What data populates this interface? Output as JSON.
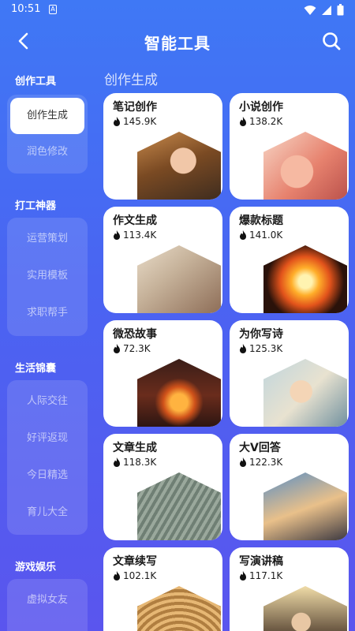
{
  "status_bar": {
    "time": "10:51",
    "sim_label": "A"
  },
  "header": {
    "title": "智能工具"
  },
  "sidebar": {
    "groups": [
      {
        "title": "创作工具",
        "items": [
          {
            "label": "创作生成",
            "active": true
          },
          {
            "label": "润色修改",
            "active": false
          }
        ]
      },
      {
        "title": "打工神器",
        "items": [
          {
            "label": "运营策划"
          },
          {
            "label": "实用模板"
          },
          {
            "label": "求职帮手"
          }
        ]
      },
      {
        "title": "生活锦囊",
        "items": [
          {
            "label": "人际交往"
          },
          {
            "label": "好评返现"
          },
          {
            "label": "今日精选"
          },
          {
            "label": "育儿大全"
          }
        ]
      },
      {
        "title": "游戏娱乐",
        "items": [
          {
            "label": "虚拟女友"
          }
        ]
      }
    ]
  },
  "main": {
    "section_title": "创作生成",
    "cards": [
      {
        "title": "笔记创作",
        "count": "145.9K",
        "image": "portrait-woman"
      },
      {
        "title": "小说创作",
        "count": "138.2K",
        "image": "writing-pen"
      },
      {
        "title": "作文生成",
        "count": "113.4K",
        "image": "hand-writing"
      },
      {
        "title": "爆款标题",
        "count": "141.0K",
        "image": "explosion"
      },
      {
        "title": "微恐故事",
        "count": "72.3K",
        "image": "jack-o-lantern"
      },
      {
        "title": "为你写诗",
        "count": "125.3K",
        "image": "anime-boy"
      },
      {
        "title": "文章生成",
        "count": "118.3K",
        "image": "paper-sculpture"
      },
      {
        "title": "大V回答",
        "count": "122.3K",
        "image": "business-people"
      },
      {
        "title": "文章续写",
        "count": "102.1K",
        "image": "open-book"
      },
      {
        "title": "写演讲稿",
        "count": "117.1K",
        "image": "speaker"
      }
    ]
  },
  "icons": {
    "back": "chevron-left-icon",
    "search": "search-icon",
    "flame": "flame-icon"
  }
}
